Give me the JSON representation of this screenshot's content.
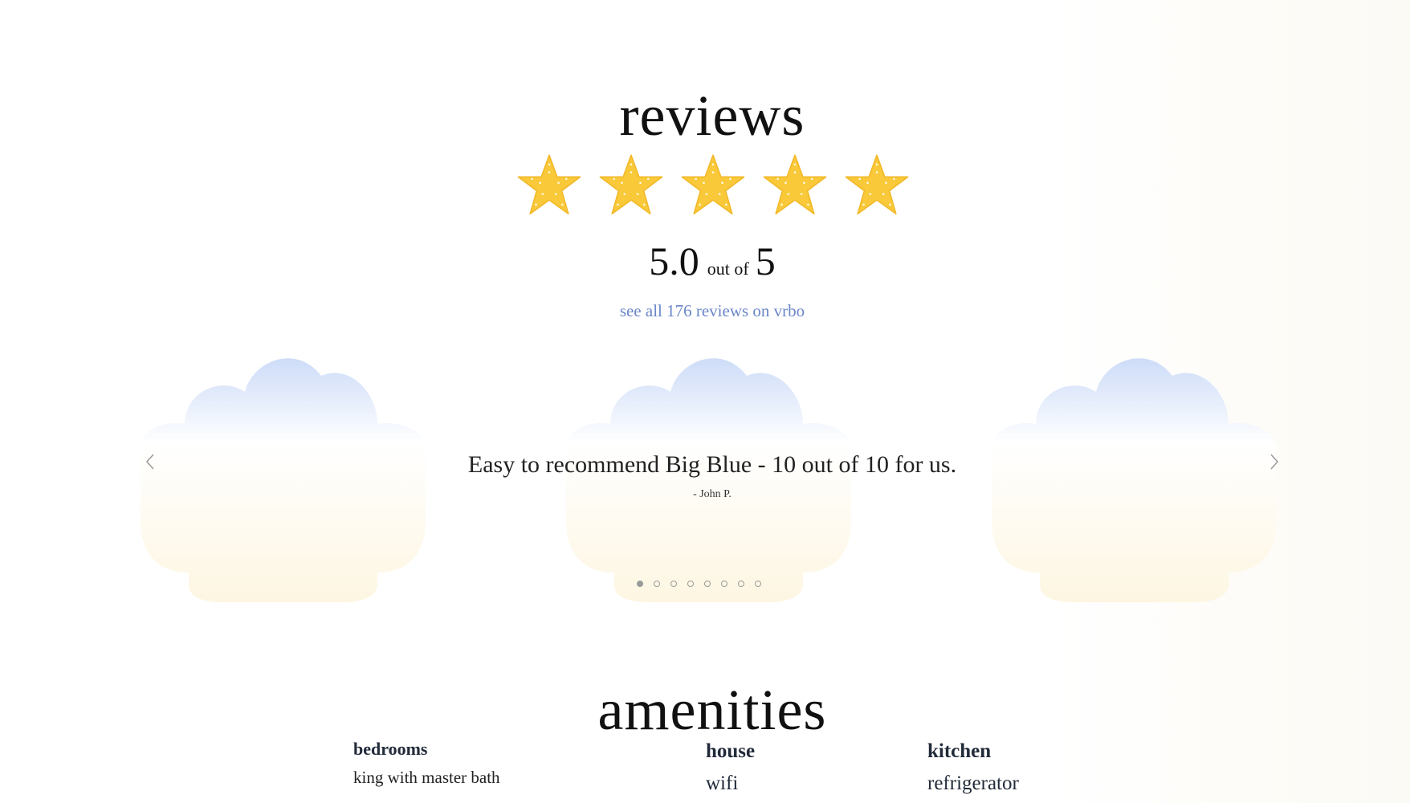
{
  "reviews": {
    "title": "reviews",
    "rating": {
      "value": "5.0",
      "out_of_label": "out of",
      "max": "5",
      "stars_filled": 5,
      "stars_total": 5,
      "star_color": "#F9C93A"
    },
    "link_text": "see all 176 reviews on vrbo",
    "link_color": "#6B87C9"
  },
  "carousel": {
    "quote": "Easy to recommend Big Blue - 10 out of 10 for us.",
    "author": "- John P.",
    "slide_count": 8,
    "active_slide": 1,
    "cloud_top_color": "#CFDDF8",
    "cloud_bottom_color": "#FDF7E4"
  },
  "amenities": {
    "title": "amenities",
    "columns": [
      {
        "heading": "bedrooms",
        "items": [
          "king with master bath"
        ]
      },
      {
        "heading": "house",
        "items": [
          "wifi"
        ]
      },
      {
        "heading": "kitchen",
        "items": [
          "refrigerator"
        ]
      }
    ]
  }
}
